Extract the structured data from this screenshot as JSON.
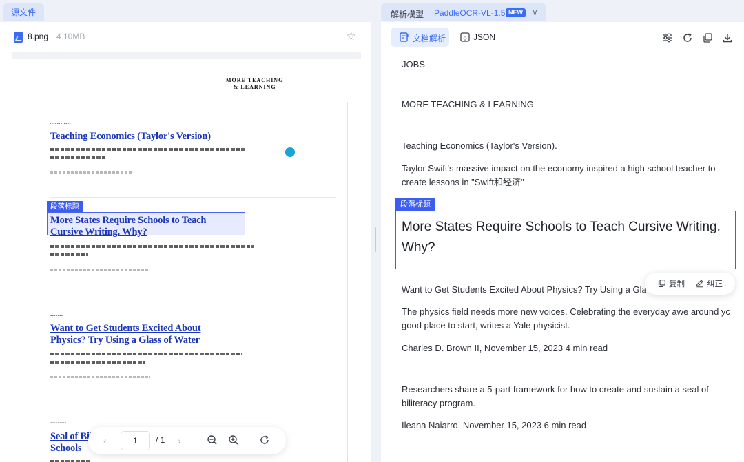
{
  "left_panel": {
    "tab_label": "源文件",
    "file_name": "8.png",
    "file_size": "4.10MB",
    "pager": {
      "current_page": "1",
      "total_pages": "/ 1"
    }
  },
  "right_panel": {
    "model_label": "解析模型",
    "model_name": "PaddleOCR-VL-1.5",
    "model_badge": "NEW",
    "tabs": [
      "文档解析",
      "JSON"
    ],
    "label_tag": "段落标题",
    "paragraphs": {
      "p1": "JOBS",
      "p2": "MORE TEACHING & LEARNING",
      "p3": "Teaching Economics (Taylor's Version).",
      "p4": "Taylor Swift's massive impact on the economy inspired a high school teacher to create lessons in \"Swift和经济\"",
      "heading": "More States Require Schools to Teach Cursive Writing. Why?",
      "p5": "Want to Get Students Excited About Physics? Try Using a Glass of Water",
      "p6": "The physics field needs more new voices. Celebrating the everyday awe around yc good place to start, writes a Yale physicist.",
      "p7": "Charles D. Brown II, November 15, 2023 4 min read",
      "p8": "Researchers share a 5-part framework for how to create and sustain a seal of biliteracy program.",
      "p9": "Ileana Naiarro, November 15, 2023 6 min read"
    },
    "popover": {
      "copy": "复制",
      "correct": "纠正"
    }
  },
  "document_image": {
    "label_tag": "段落标题",
    "masthead": "MORE TEACHING\n& LEARNING",
    "articles": [
      {
        "title_line1": "Teaching Economics (Taylor's Version)",
        "title_line2": ""
      },
      {
        "title_line1": "More States Require Schools to Teach",
        "title_line2": "Cursive Writing. Why?"
      },
      {
        "title_line1": "Want to Get Students Excited About",
        "title_line2": "Physics? Try Using a Glass of Water"
      },
      {
        "title_line1": "Seal of Biliteracy Programs: A Guide for",
        "title_line2": "Schools"
      }
    ]
  },
  "colors": {
    "accent": "#3a6cf4",
    "highlight": "#3d5cf0",
    "link_blue": "#1a35b8"
  }
}
